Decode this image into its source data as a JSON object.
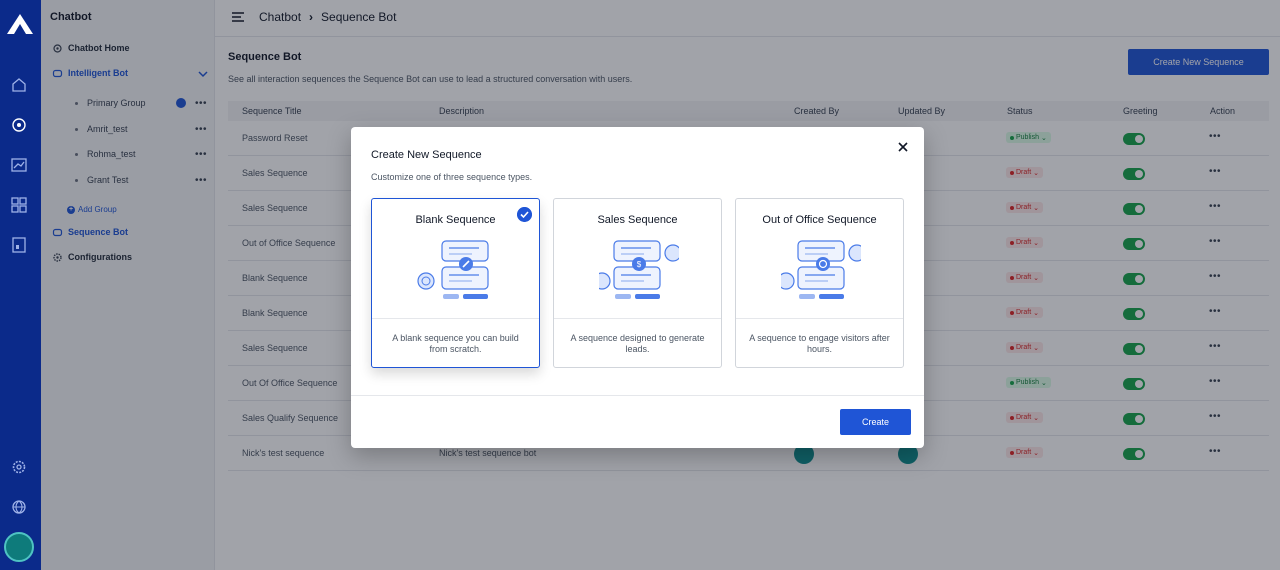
{
  "sidebar": {
    "title": "Chatbot",
    "items": {
      "home": "Chatbot Home",
      "intelligent": "Intelligent Bot",
      "sequence": "Sequence Bot",
      "config": "Configurations"
    },
    "groups": [
      "Primary Group",
      "Amrit_test",
      "Rohma_test",
      "Grant Test"
    ],
    "add_group": "Add Group"
  },
  "breadcrumb": {
    "root": "Chatbot",
    "sep": "›",
    "current": "Sequence Bot"
  },
  "page": {
    "title": "Sequence Bot",
    "description": "See all interaction sequences the Sequence Bot can use to lead a structured conversation with users.",
    "new_button": "Create New Sequence"
  },
  "table": {
    "headers": [
      "Sequence Title",
      "Description",
      "Created By",
      "Updated By",
      "Status",
      "Greeting",
      "Action"
    ],
    "rows": [
      {
        "title": "Password Reset",
        "description": "",
        "status": "Publish"
      },
      {
        "title": "Sales Sequence",
        "description": "",
        "status": "Draft"
      },
      {
        "title": "Sales Sequence",
        "description": "",
        "status": "Draft"
      },
      {
        "title": "Out of Office Sequence",
        "description": "",
        "status": "Draft"
      },
      {
        "title": "Blank Sequence",
        "description": "",
        "status": "Draft"
      },
      {
        "title": "Blank Sequence",
        "description": "",
        "status": "Draft"
      },
      {
        "title": "Sales Sequence",
        "description": "",
        "status": "Draft"
      },
      {
        "title": "Out Of Office Sequence",
        "description": "",
        "status": "Publish"
      },
      {
        "title": "Sales Qualify Sequence",
        "description": "",
        "status": "Draft"
      },
      {
        "title": "Nick's test sequence",
        "description": "Nick's test sequence bot",
        "status": "Draft"
      }
    ],
    "action_glyph": "•••"
  },
  "modal": {
    "title": "Create New Sequence",
    "subtitle": "Customize one of three sequence types.",
    "close_glyph": "✕",
    "cards": [
      {
        "title": "Blank Sequence",
        "description": "A blank sequence you can build from scratch.",
        "selected": true
      },
      {
        "title": "Sales Sequence",
        "description": "A sequence designed to generate leads.",
        "selected": false
      },
      {
        "title": "Out of Office Sequence",
        "description": "A sequence to engage visitors after hours.",
        "selected": false
      }
    ],
    "create_button": "Create"
  },
  "colors": {
    "accent": "#1f55d6",
    "rail": "#0b2a8a",
    "publish": "#16a34a",
    "draft": "#dc2626"
  }
}
